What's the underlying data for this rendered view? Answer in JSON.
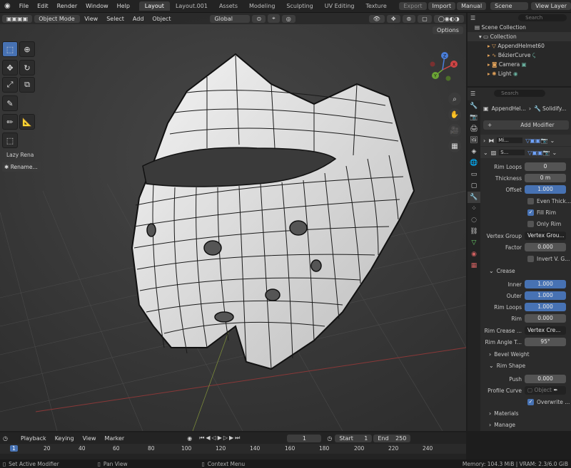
{
  "topbar": {
    "menus": [
      "File",
      "Edit",
      "Render",
      "Window",
      "Help"
    ],
    "workspaces": [
      "Layout",
      "Layout.001",
      "Assets",
      "Modeling",
      "Sculpting",
      "UV Editing",
      "Texture"
    ],
    "active_workspace": "Layout",
    "export_label": "Export",
    "import_label": "Import",
    "manual_label": "Manual",
    "scene_label": "Scene",
    "view_layer_label": "View Layer"
  },
  "viewport": {
    "mode": "Object Mode",
    "header_menus": [
      "View",
      "Select",
      "Add",
      "Object"
    ],
    "orientation": "Global",
    "options_label": "Options",
    "last_op_title": "Lazy Rena",
    "last_op_button": "Rename...",
    "gizmo_axes": [
      "X",
      "Y",
      "Z"
    ]
  },
  "outliner": {
    "search_placeholder": "Search",
    "root": "Scene Collection",
    "collection": "Collection",
    "items": [
      "AppendHelmet60",
      "BézierCurve",
      "Camera",
      "Light"
    ]
  },
  "properties": {
    "search_placeholder": "Search",
    "breadcrumb_object": "AppendHel...",
    "breadcrumb_modifier": "Solidify...",
    "add_modifier": "Add Modifier",
    "modifier1_name": "Mi...",
    "modifier2_name": "S...",
    "rows": {
      "rim_loops": {
        "label": "Rim Loops",
        "value": "0"
      },
      "thickness": {
        "label": "Thickness",
        "value": "0 m"
      },
      "offset": {
        "label": "Offset",
        "value": "1.000"
      },
      "even_thickness": "Even Thick...",
      "fill_rim": "Fill Rim",
      "only_rim": "Only Rim",
      "vertex_group": {
        "label": "Vertex Group",
        "value": "Vertex Grou..."
      },
      "factor": {
        "label": "Factor",
        "value": "0.000"
      },
      "invert": "Invert V. G..."
    },
    "crease": {
      "title": "Crease",
      "inner": {
        "label": "Inner",
        "value": "1.000"
      },
      "outer": {
        "label": "Outer",
        "value": "1.000"
      },
      "rim_loops": {
        "label": "Rim Loops",
        "value": "1.000"
      },
      "rim": {
        "label": "Rim",
        "value": "0.000"
      },
      "rim_crease": {
        "label": "Rim Crease ...",
        "value": "Vertex Cre..."
      },
      "rim_angle": {
        "label": "Rim Angle T...",
        "value": "95°"
      }
    },
    "bevel_weight": "Bevel Weight",
    "rim_shape": {
      "title": "Rim Shape",
      "push": {
        "label": "Push",
        "value": "0.000"
      },
      "profile_curve": {
        "label": "Profile Curve",
        "value": "Object"
      },
      "overwrite": "Overwrite ..."
    },
    "materials": "Materials",
    "manage": "Manage"
  },
  "timeline": {
    "menus": [
      "Playback",
      "Keying",
      "View",
      "Marker"
    ],
    "current_frame": "1",
    "start_label": "Start",
    "start_value": "1",
    "end_label": "End",
    "end_value": "250",
    "ruler_current": "1",
    "ruler": [
      "20",
      "40",
      "60",
      "80",
      "100",
      "120",
      "140",
      "160",
      "180",
      "200",
      "220",
      "240"
    ]
  },
  "status": {
    "left": "Set Active Modifier",
    "middle": "Pan View",
    "context": "Context Menu",
    "memory": "Memory: 104.3 MiB | VRAM: 2.3/6.0 GiB"
  },
  "colors": {
    "accent": "#4772b3",
    "bg": "#1d1d1d",
    "panel": "#2b2b2b"
  }
}
